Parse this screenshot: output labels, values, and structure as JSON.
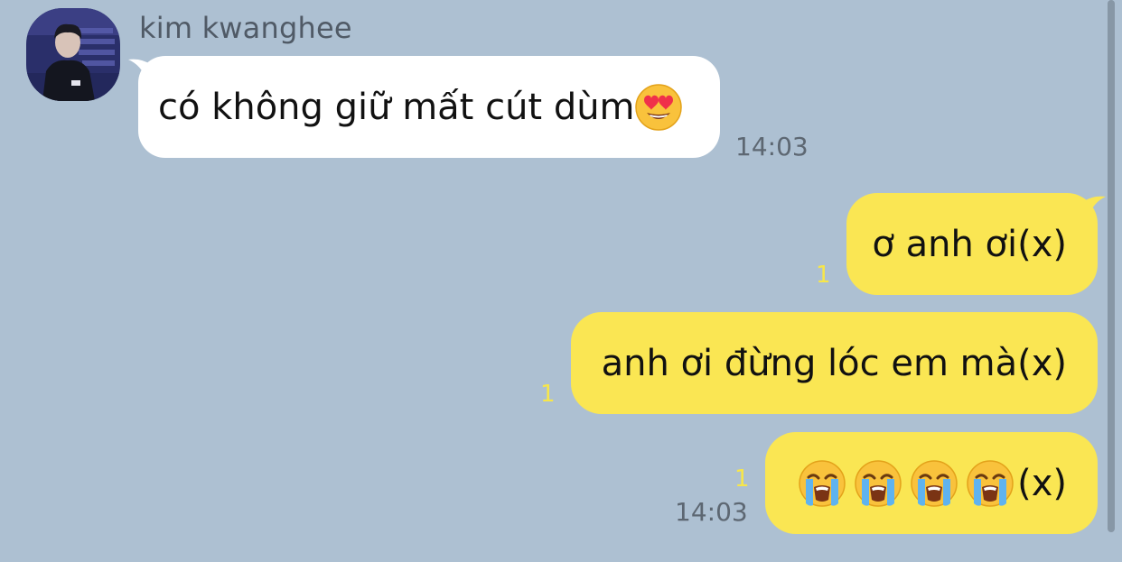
{
  "incoming": {
    "sender": "kim kwanghee",
    "text": "có không giữ mất cút dùm",
    "emoji_icon": "heart-eyes-emoji",
    "time": "14:03"
  },
  "outgoing": [
    {
      "text": "ơ anh ơi(x)",
      "unread": "1"
    },
    {
      "text": "anh ơi đừng lóc em mà(x)",
      "unread": "1"
    },
    {
      "suffix": "(x)",
      "emoji_icon": "loudly-crying-emoji",
      "emoji_count": 4,
      "unread": "1",
      "time": "14:03"
    }
  ],
  "colors": {
    "background": "#adc0d2",
    "incoming_bubble": "#ffffff",
    "outgoing_bubble": "#fae653",
    "unread_count": "#f7e64a"
  }
}
